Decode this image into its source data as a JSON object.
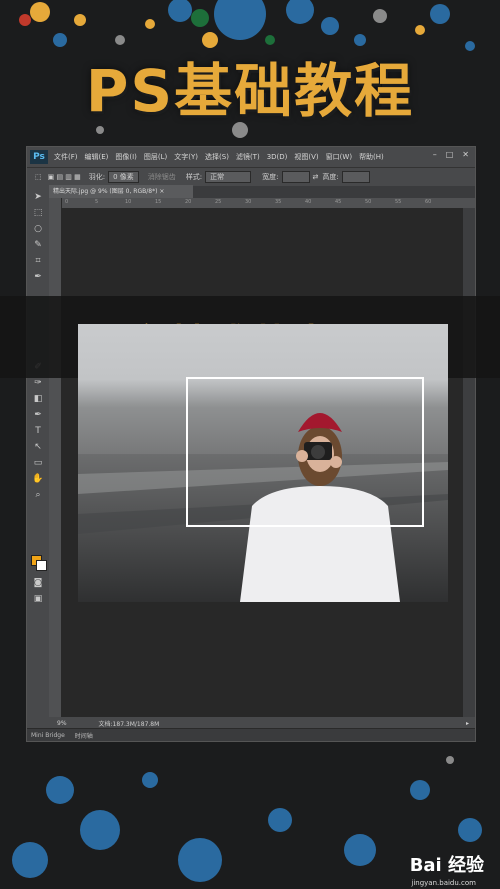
{
  "header": {
    "title": "PS基础教程"
  },
  "banner": {
    "title": "穿越感艺术照"
  },
  "app": {
    "logo": "Ps",
    "menu": [
      "文件(F)",
      "编辑(E)",
      "图像(I)",
      "图层(L)",
      "文字(Y)",
      "选择(S)",
      "滤镜(T)",
      "3D(D)",
      "视图(V)",
      "窗口(W)",
      "帮助(H)"
    ],
    "options": {
      "feather_label": "羽化:",
      "feather_value": "0 像素",
      "antialias": "消除锯齿",
      "style_label": "样式:",
      "style_value": "正常",
      "width_label": "宽度:",
      "height_label": "高度:"
    },
    "doc_tab": "精出天际.jpg @ 9% (图层 0, RGB/8*) ×",
    "ruler_ticks": [
      "0",
      "5",
      "10",
      "15",
      "20",
      "25",
      "30",
      "35",
      "40",
      "45",
      "50",
      "55",
      "60"
    ],
    "status": {
      "zoom": "9%",
      "doc": "文档:187.3M/187.8M"
    },
    "bottom_tabs": [
      "Mini Bridge",
      "时间轴"
    ]
  },
  "watermark": {
    "brand": "Bai 经验",
    "url": "jingyan.baidu.com"
  },
  "colors": {
    "accent": "#e6a93a",
    "foreground": "#f1a517",
    "background": "#ffffff"
  }
}
